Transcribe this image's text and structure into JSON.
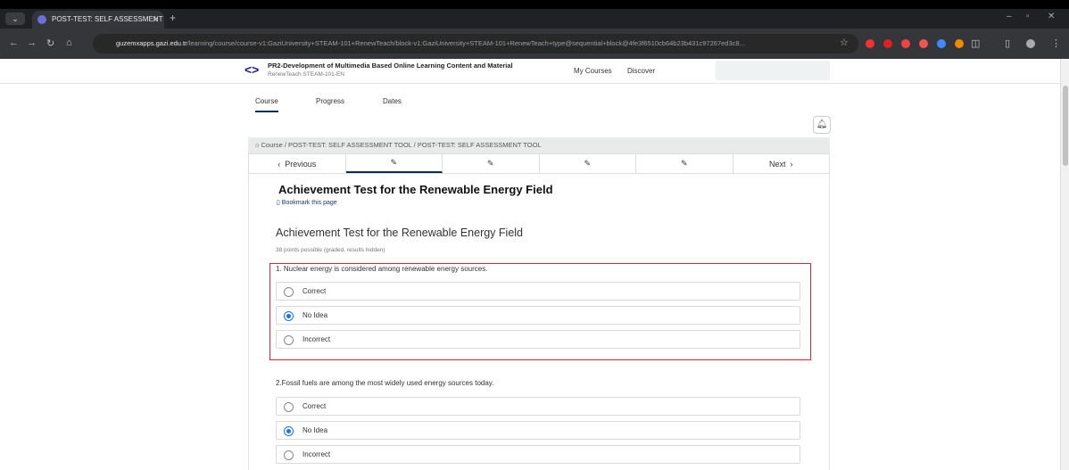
{
  "browser": {
    "tab_title": "POST-TEST: SELF ASSESSMENT",
    "url_host": "guzemxapps.gazi.edu.tr",
    "url_path": "/learning/course/course-v1:GaziUniversity+STEAM-101+RenewTeach/block-v1:GaziUniversity+STEAM-101+RenewTeach+type@sequential+block@4fe3f6510cb64b23b431c97267ed3c8..."
  },
  "header": {
    "course_title": "PR2-Development of Multimedia Based Online Learning Content and Material",
    "course_code": "RenewTeach STEAM-101-EN",
    "nav_my_courses": "My Courses",
    "nav_discover": "Discover"
  },
  "course_tabs": {
    "course": "Course",
    "progress": "Progress",
    "dates": "Dates"
  },
  "breadcrumb": "Course  /  POST-TEST: SELF ASSESSMENT TOOL  /  POST-TEST: SELF ASSESSMENT TOOL",
  "seq": {
    "previous": "Previous",
    "next": "Next"
  },
  "unit_title": "Achievement Test for the Renewable Energy Field",
  "bookmark": "Bookmark this page",
  "problem_title": "Achievement Test for the Renewable Energy Field",
  "points": "38 points possible (graded, results hidden)",
  "questions": [
    {
      "text": "1. Nuclear energy is considered among renewable energy sources.",
      "options": [
        "Correct",
        "No Idea",
        "Incorrect"
      ],
      "selected": "No Idea"
    },
    {
      "text": "2.Fossil fuels are among the most widely used energy sources today.",
      "options": [
        "Correct",
        "No Idea",
        "Incorrect"
      ],
      "selected": "No Idea"
    }
  ],
  "colors": {
    "highlight": "#d9262c",
    "radio_selected": "#1a73e8",
    "accent": "#0a3055"
  }
}
